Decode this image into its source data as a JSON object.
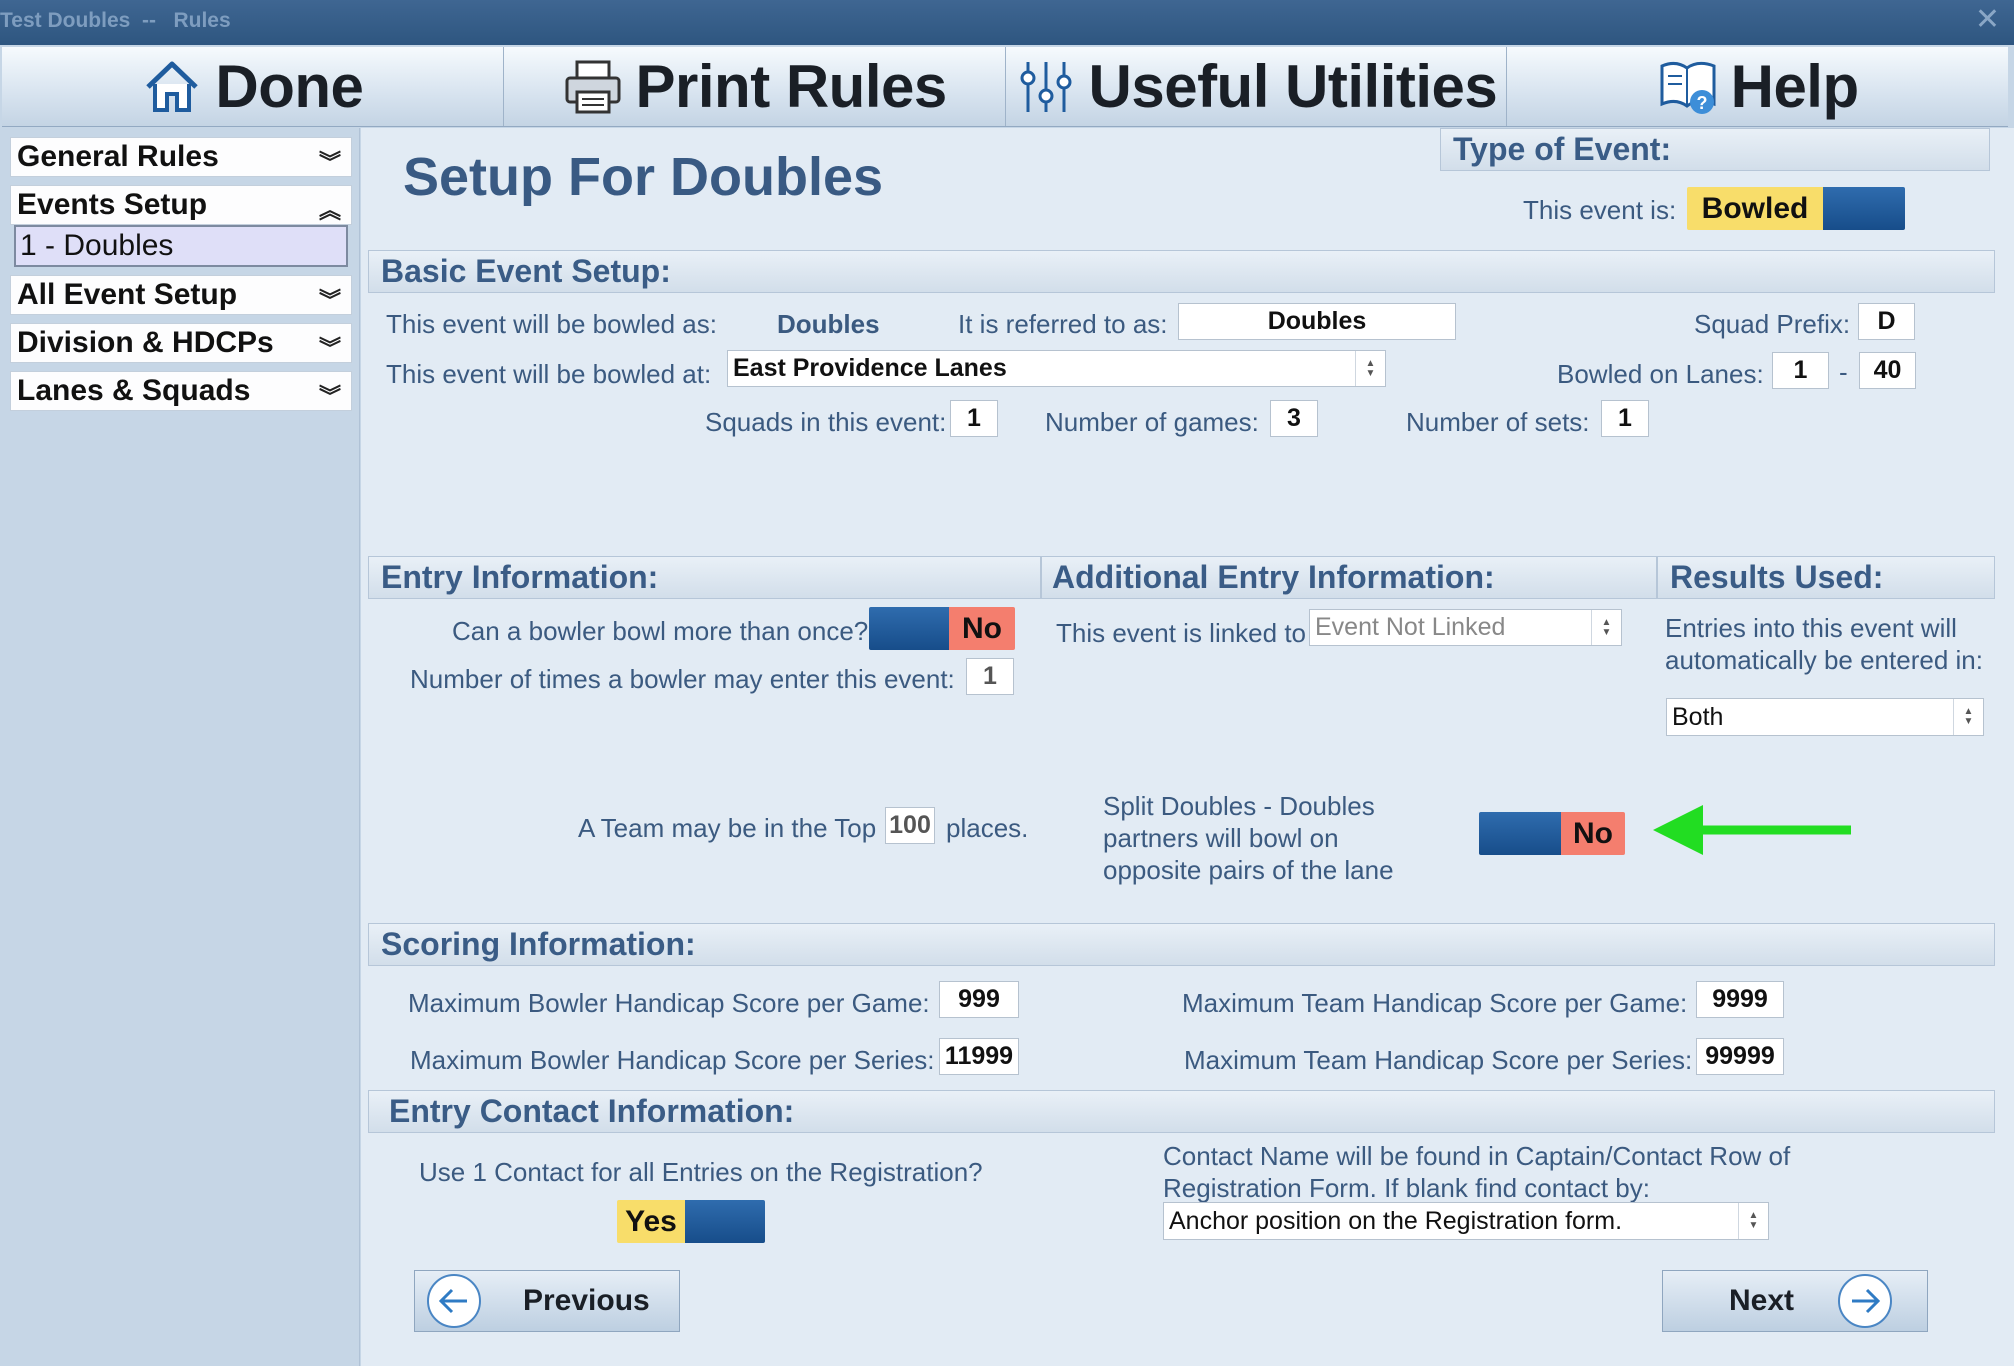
{
  "window": {
    "title": "Test Doubles  --   Rules",
    "close_glyph": "✕"
  },
  "toolbar": [
    {
      "label": "Done",
      "icon": "home-icon"
    },
    {
      "label": "Print Rules",
      "icon": "printer-icon"
    },
    {
      "label": "Useful Utilities",
      "icon": "sliders-icon"
    },
    {
      "label": "Help",
      "icon": "help-book-icon"
    }
  ],
  "sidebar": {
    "general_rules": "General Rules",
    "events_setup": "Events Setup",
    "selected_event": "1 - Doubles",
    "all_event_setup": "All Event Setup",
    "division_hdcps": "Division & HDCPs",
    "lanes_squads": "Lanes & Squads",
    "chev_down": "︾",
    "chev_up": "︽"
  },
  "page": {
    "title": "Setup For Doubles"
  },
  "type_of_event": {
    "heading": "Type of Event:",
    "label": "This event is:",
    "toggle_value": "Bowled"
  },
  "basic": {
    "heading": "Basic Event Setup:",
    "bowled_as_label": "This event will be bowled as:",
    "bowled_as_value": "Doubles",
    "referred_label": "It is referred to as:",
    "referred_value": "Doubles",
    "squad_prefix_label": "Squad Prefix:",
    "squad_prefix_value": "D",
    "bowled_at_label": "This event will be bowled at:",
    "bowled_at_value": "East Providence Lanes",
    "lanes_label": "Bowled on Lanes:",
    "lane_from": "1",
    "lane_dash": "-",
    "lane_to": "40",
    "squads_label": "Squads in this event:",
    "squads_value": "1",
    "games_label": "Number of games:",
    "games_value": "3",
    "sets_label": "Number of sets:",
    "sets_value": "1"
  },
  "entry": {
    "heading": "Entry Information:",
    "more_than_once_label": "Can a bowler bowl more than once?",
    "more_than_once_value": "No",
    "times_label": "Number of times a bowler may enter this event:",
    "times_value": "1",
    "top_prefix": "A Team may be in the Top",
    "top_value": "100",
    "top_suffix": "places."
  },
  "additional": {
    "heading": "Additional Entry Information:",
    "linked_label": "This event is linked to",
    "linked_value": "Event Not Linked",
    "split_label": "Split Doubles - Doubles partners will bowl on opposite pairs of the lane",
    "split_value": "No"
  },
  "results": {
    "heading": "Results Used:",
    "text": "Entries into this event will automatically be entered in:",
    "value": "Both"
  },
  "scoring": {
    "heading": "Scoring Information:",
    "bowler_game_label": "Maximum Bowler Handicap Score per Game:",
    "bowler_game_value": "999",
    "bowler_series_label": "Maximum Bowler Handicap Score per Series:",
    "bowler_series_value": "11999",
    "team_game_label": "Maximum Team Handicap Score per Game:",
    "team_game_value": "9999",
    "team_series_label": "Maximum Team Handicap Score per Series:",
    "team_series_value": "99999"
  },
  "contact": {
    "heading": "Entry Contact Information:",
    "one_contact_label": "Use 1 Contact for all Entries on the Registration?",
    "one_contact_value": "Yes",
    "contact_note": "Contact Name will be found in Captain/Contact Row of Registration Form. If blank find contact by:",
    "contact_by_value": "Anchor position on the Registration form."
  },
  "nav": {
    "previous": "Previous",
    "next": "Next"
  },
  "colors": {
    "annotation_arrow": "#22dd22",
    "toggle_blue": "#1f5c9e",
    "no_red": "#f47e6e",
    "yes_yellow": "#f8dd6a"
  }
}
